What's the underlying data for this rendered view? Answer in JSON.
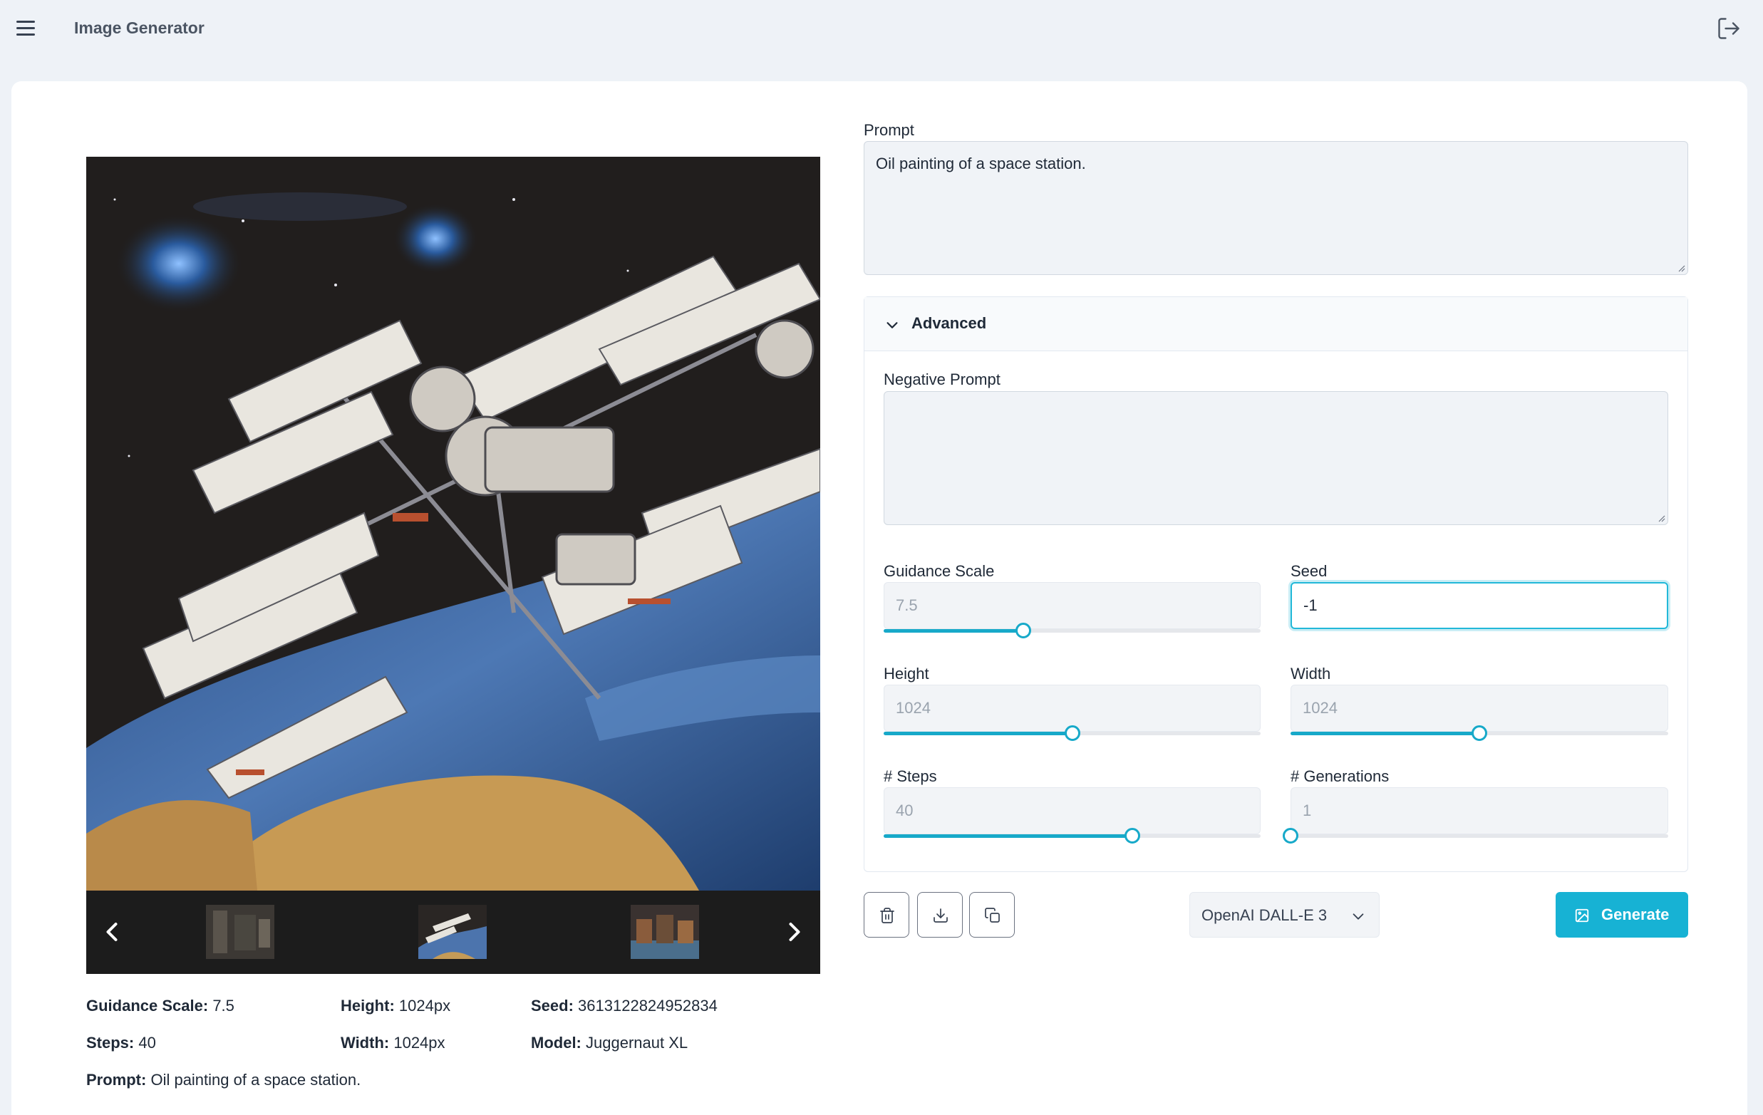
{
  "app": {
    "title": "Image Generator"
  },
  "prompt": {
    "label": "Prompt",
    "value": "Oil painting of a space station."
  },
  "advanced": {
    "title": "Advanced",
    "negative_prompt": {
      "label": "Negative Prompt",
      "value": ""
    },
    "guidance_scale": {
      "label": "Guidance Scale",
      "placeholder": "7.5",
      "slider_fraction": 0.37
    },
    "seed": {
      "label": "Seed",
      "value": "-1"
    },
    "height": {
      "label": "Height",
      "placeholder": "1024",
      "slider_fraction": 0.5
    },
    "width": {
      "label": "Width",
      "placeholder": "1024",
      "slider_fraction": 0.5
    },
    "steps": {
      "label": "# Steps",
      "placeholder": "40",
      "slider_fraction": 0.66
    },
    "generations": {
      "label": "# Generations",
      "placeholder": "1",
      "slider_fraction": 0.0
    }
  },
  "actions": {
    "delete_icon": "trash-icon",
    "download_icon": "download-icon",
    "copy_icon": "copy-icon",
    "model_selected": "OpenAI DALL-E 3",
    "generate_label": "Generate"
  },
  "image_meta": {
    "guidance_label": "Guidance Scale:",
    "guidance_value": "7.5",
    "height_label": "Height:",
    "height_value": "1024px",
    "seed_label": "Seed:",
    "seed_value": "3613122824952834",
    "steps_label": "Steps:",
    "steps_value": "40",
    "width_label": "Width:",
    "width_value": "1024px",
    "model_label": "Model:",
    "model_value": "Juggernaut XL",
    "prompt_label": "Prompt:",
    "prompt_value": "Oil painting of a space station."
  },
  "colors": {
    "accent": "#17b2d4",
    "background": "#eef2f7"
  }
}
